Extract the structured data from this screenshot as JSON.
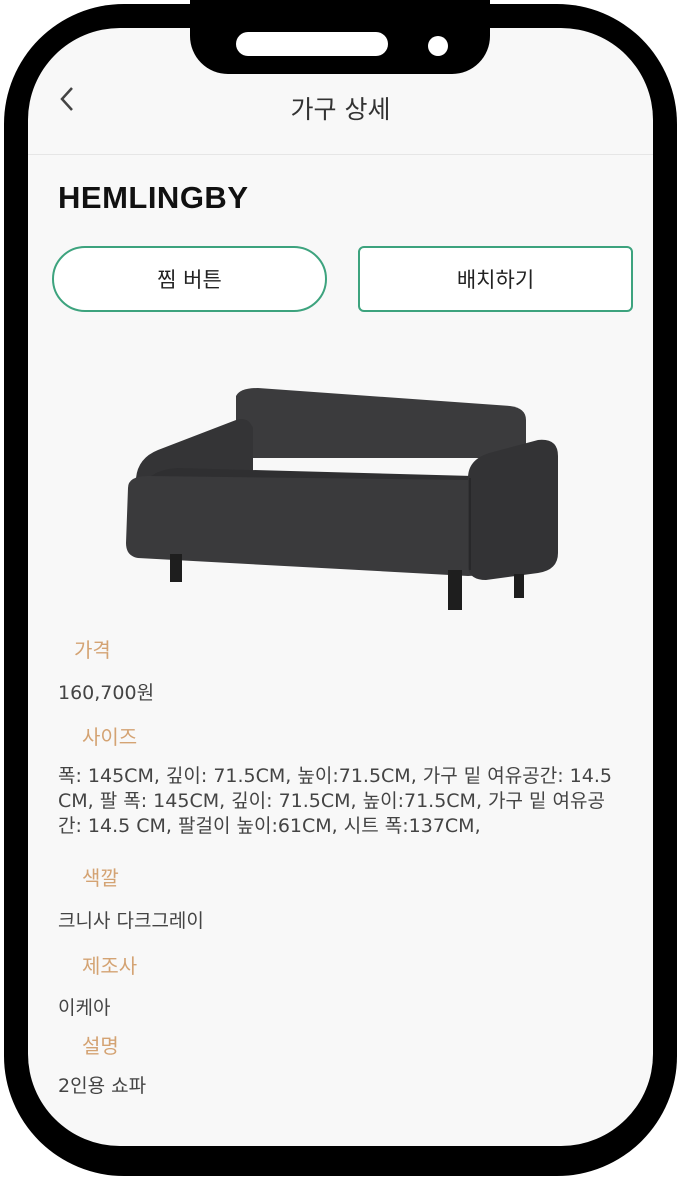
{
  "header": {
    "title": "가구 상세"
  },
  "product": {
    "name": "HEMLINGBY",
    "fav_button": "찜 버튼",
    "place_button": "배치하기",
    "price_label": "가격",
    "price": "160,700원",
    "size_label": "사이즈",
    "size": "폭: 145CM, 깊이: 71.5CM, 높이:71.5CM, 가구 밑 여유공간: 14.5 CM, 팔 폭: 145CM, 깊이: 71.5CM, 높이:71.5CM, 가구 밑 여유공간: 14.5 CM, 팔걸이 높이:61CM, 시트 폭:137CM,",
    "color_label": "색깔",
    "color": "크니사 다크그레이",
    "maker_label": "제조사",
    "maker": "이케아",
    "desc_label": "설명",
    "desc": "2인용 쇼파"
  },
  "colors": {
    "accent": "#3da37e",
    "label": "#d4a373"
  }
}
